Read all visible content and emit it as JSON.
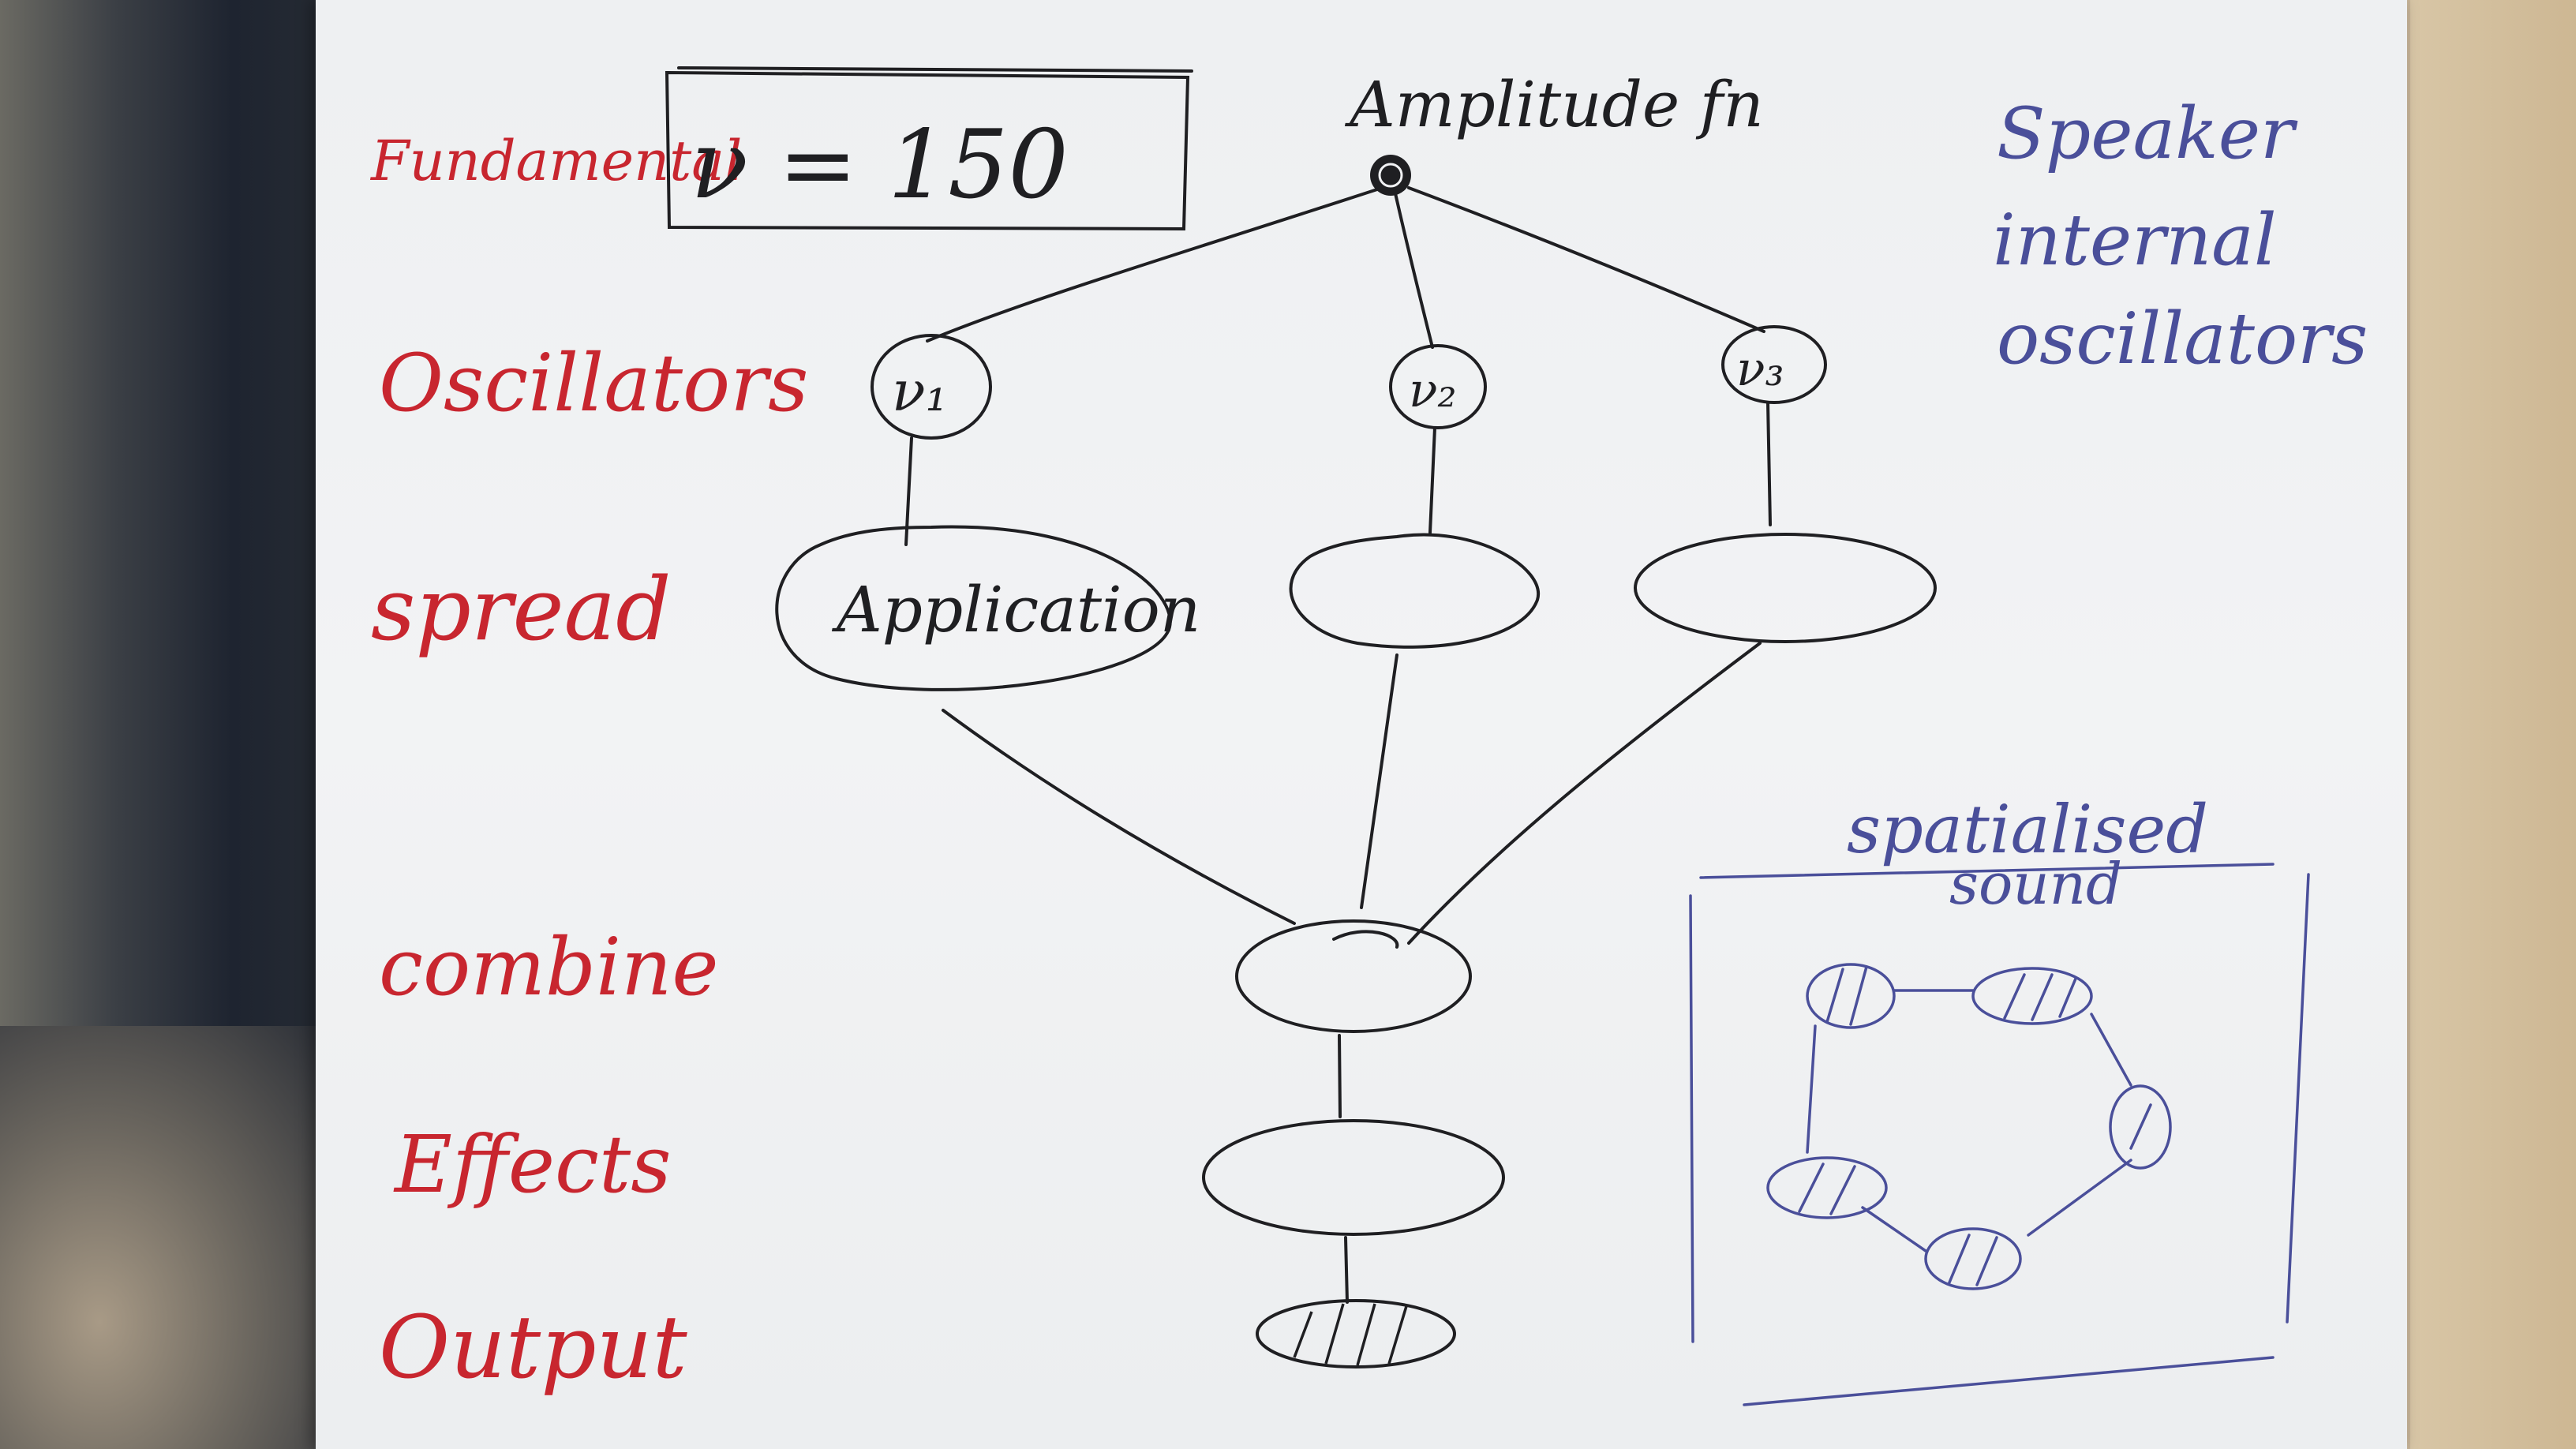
{
  "stage_labels": {
    "fundamental": "Fundamental",
    "oscillators": "Oscillators",
    "spread": "spread",
    "combine": "combine",
    "effects": "Effects",
    "output": "Output"
  },
  "fundamental_box": {
    "text": "ν = 150"
  },
  "amplitude_label": "Amplitude fn",
  "oscillator_nodes": [
    "ν₁",
    "ν₂",
    "ν₃"
  ],
  "spread_nodes": [
    "Application",
    "",
    ""
  ],
  "side_note": [
    "Speaker",
    "internal",
    "oscillators"
  ],
  "spatialised_title": [
    "spatialised",
    "sound"
  ],
  "colors": {
    "stage_labels": "#c8262f",
    "notes": "#4a4f9a",
    "ink": "#1f1f22",
    "paper": "#f0f1f3"
  }
}
